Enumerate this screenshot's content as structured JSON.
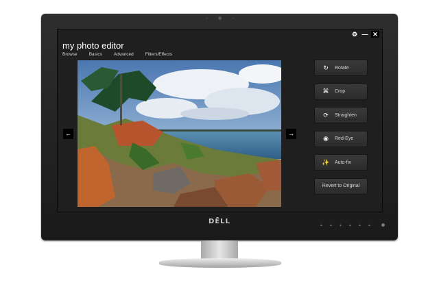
{
  "app": {
    "title": "my photo editor",
    "nav": [
      "Browse",
      "Basics",
      "Advanced",
      "Filters/Effects"
    ]
  },
  "window_controls": {
    "settings_icon": "⚙",
    "minimize_icon": "—",
    "close_icon": "✕"
  },
  "photo": {
    "prev_icon": "←",
    "next_icon": "→"
  },
  "actions": [
    {
      "label": "Rotate",
      "icon": "↻"
    },
    {
      "label": "Crop",
      "icon": "⌘"
    },
    {
      "label": "Straighten",
      "icon": "⟳"
    },
    {
      "label": "Red-Eye",
      "icon": "◉"
    },
    {
      "label": "Auto-fix",
      "icon": "✨"
    }
  ],
  "revert_label": "Revert to Original",
  "monitor": {
    "brand": "DĒLL"
  }
}
